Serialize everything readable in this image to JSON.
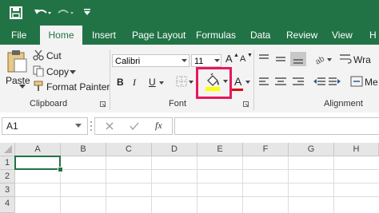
{
  "tabs": [
    "File",
    "Home",
    "Insert",
    "Page Layout",
    "Formulas",
    "Data",
    "Review",
    "View",
    "H"
  ],
  "clipboard": {
    "paste": "Paste",
    "cut": "Cut",
    "copy": "Copy",
    "format_painter": "Format Painter",
    "group": "Clipboard"
  },
  "font": {
    "name": "Calibri",
    "size": "11",
    "bold": "B",
    "italic": "I",
    "underline": "U",
    "grow": "A",
    "shrink": "A",
    "font_color": "A",
    "group": "Font"
  },
  "alignment": {
    "wrap": "Wra",
    "merge": "Me",
    "group": "Alignment"
  },
  "formula_bar": {
    "name_box": "A1",
    "fx": "fx",
    "value": ""
  },
  "grid": {
    "columns": [
      "A",
      "B",
      "C",
      "D",
      "E",
      "F",
      "G",
      "H"
    ],
    "rows": [
      "1",
      "2",
      "3",
      "4"
    ]
  },
  "colors": {
    "brand": "#217346",
    "highlight": "#e8175d",
    "fill_yellow": "#ffff00",
    "font_red": "#e00000"
  },
  "icons": [
    "save-icon",
    "undo-icon",
    "redo-icon",
    "customize-qat-icon",
    "paste-icon",
    "cut-icon",
    "copy-icon",
    "format-painter-icon",
    "borders-icon",
    "fill-color-icon",
    "font-color-icon",
    "align-icons",
    "wrap-text-icon",
    "merge-icon",
    "dialog-launcher-icon",
    "cancel-icon",
    "enter-icon"
  ]
}
